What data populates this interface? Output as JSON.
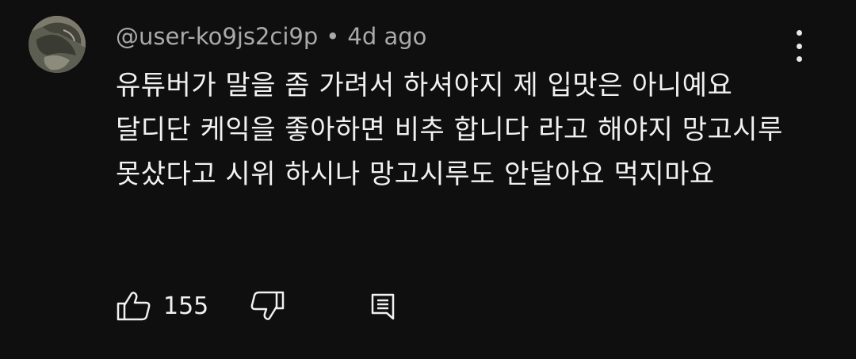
{
  "comment": {
    "author": "@user-ko9js2ci9p",
    "separator": "•",
    "time": "4d ago",
    "text": "유튜버가 말을 좀 가려서 하셔야지 제 입맛은 아니예요 달디단 케익을 좋아하면 비추 합니다 라고 해야지 망고시루 못샀다고 시위 하시나 망고시루도 안달아요 먹지마요",
    "like_count": "155"
  },
  "icons": {
    "avatar": "avatar-image",
    "more": "more-vertical-icon",
    "like": "thumbs-up-icon",
    "dislike": "thumbs-down-icon",
    "reply": "reply-comment-icon"
  },
  "colors": {
    "background": "#0f0f0f",
    "text": "#f1f1f1",
    "secondary_text": "#aaaaaa"
  }
}
